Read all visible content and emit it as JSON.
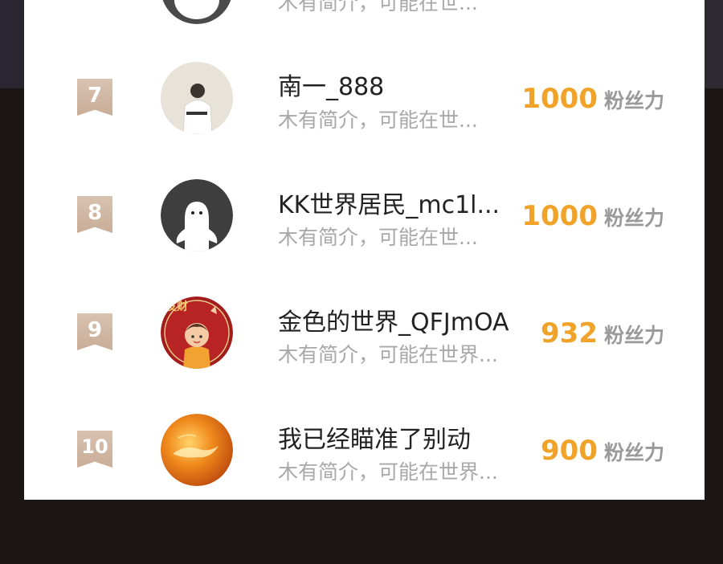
{
  "top_row": {
    "bio": "木有简介，可能在世..."
  },
  "rows": [
    {
      "rank": "7",
      "name": "南一_888",
      "bio": "木有简介，可能在世...",
      "score": "1000",
      "unit": "粉丝力"
    },
    {
      "rank": "8",
      "name": "KK世界居民_mc1l...",
      "bio": "木有简介，可能在世...",
      "score": "1000",
      "unit": "粉丝力"
    },
    {
      "rank": "9",
      "name": "金色的世界_QFJmOA",
      "bio": "木有简介，可能在世界...",
      "score": "932",
      "unit": "粉丝力"
    },
    {
      "rank": "10",
      "name": "我已经瞄准了别动",
      "bio": "木有简介，可能在世界...",
      "score": "900",
      "unit": "粉丝力"
    }
  ],
  "colors": {
    "accent": "#f0a328",
    "rank_badge": "#d0b6a2"
  },
  "avatar_badge_text": "发财"
}
